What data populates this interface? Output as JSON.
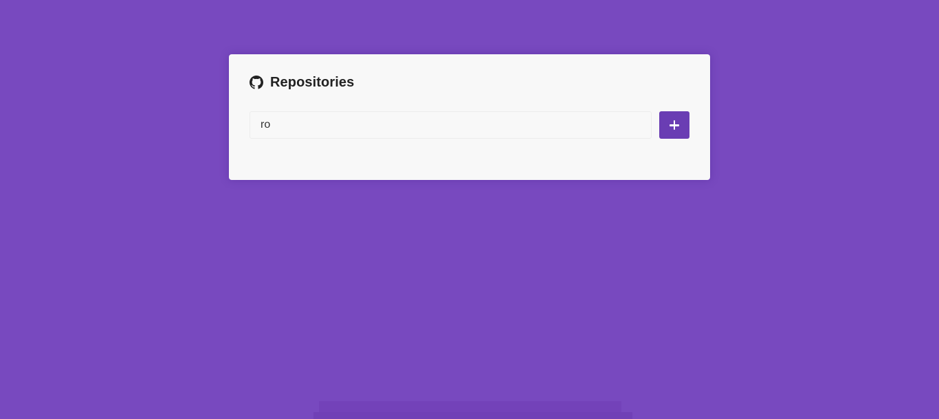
{
  "header": {
    "icon": "github-icon",
    "title": "Repositories"
  },
  "form": {
    "input_value": "ro",
    "add_button_icon": "plus-icon"
  },
  "colors": {
    "background": "#7849bf",
    "card": "#f8f8f8",
    "accent": "#6a3db3"
  }
}
